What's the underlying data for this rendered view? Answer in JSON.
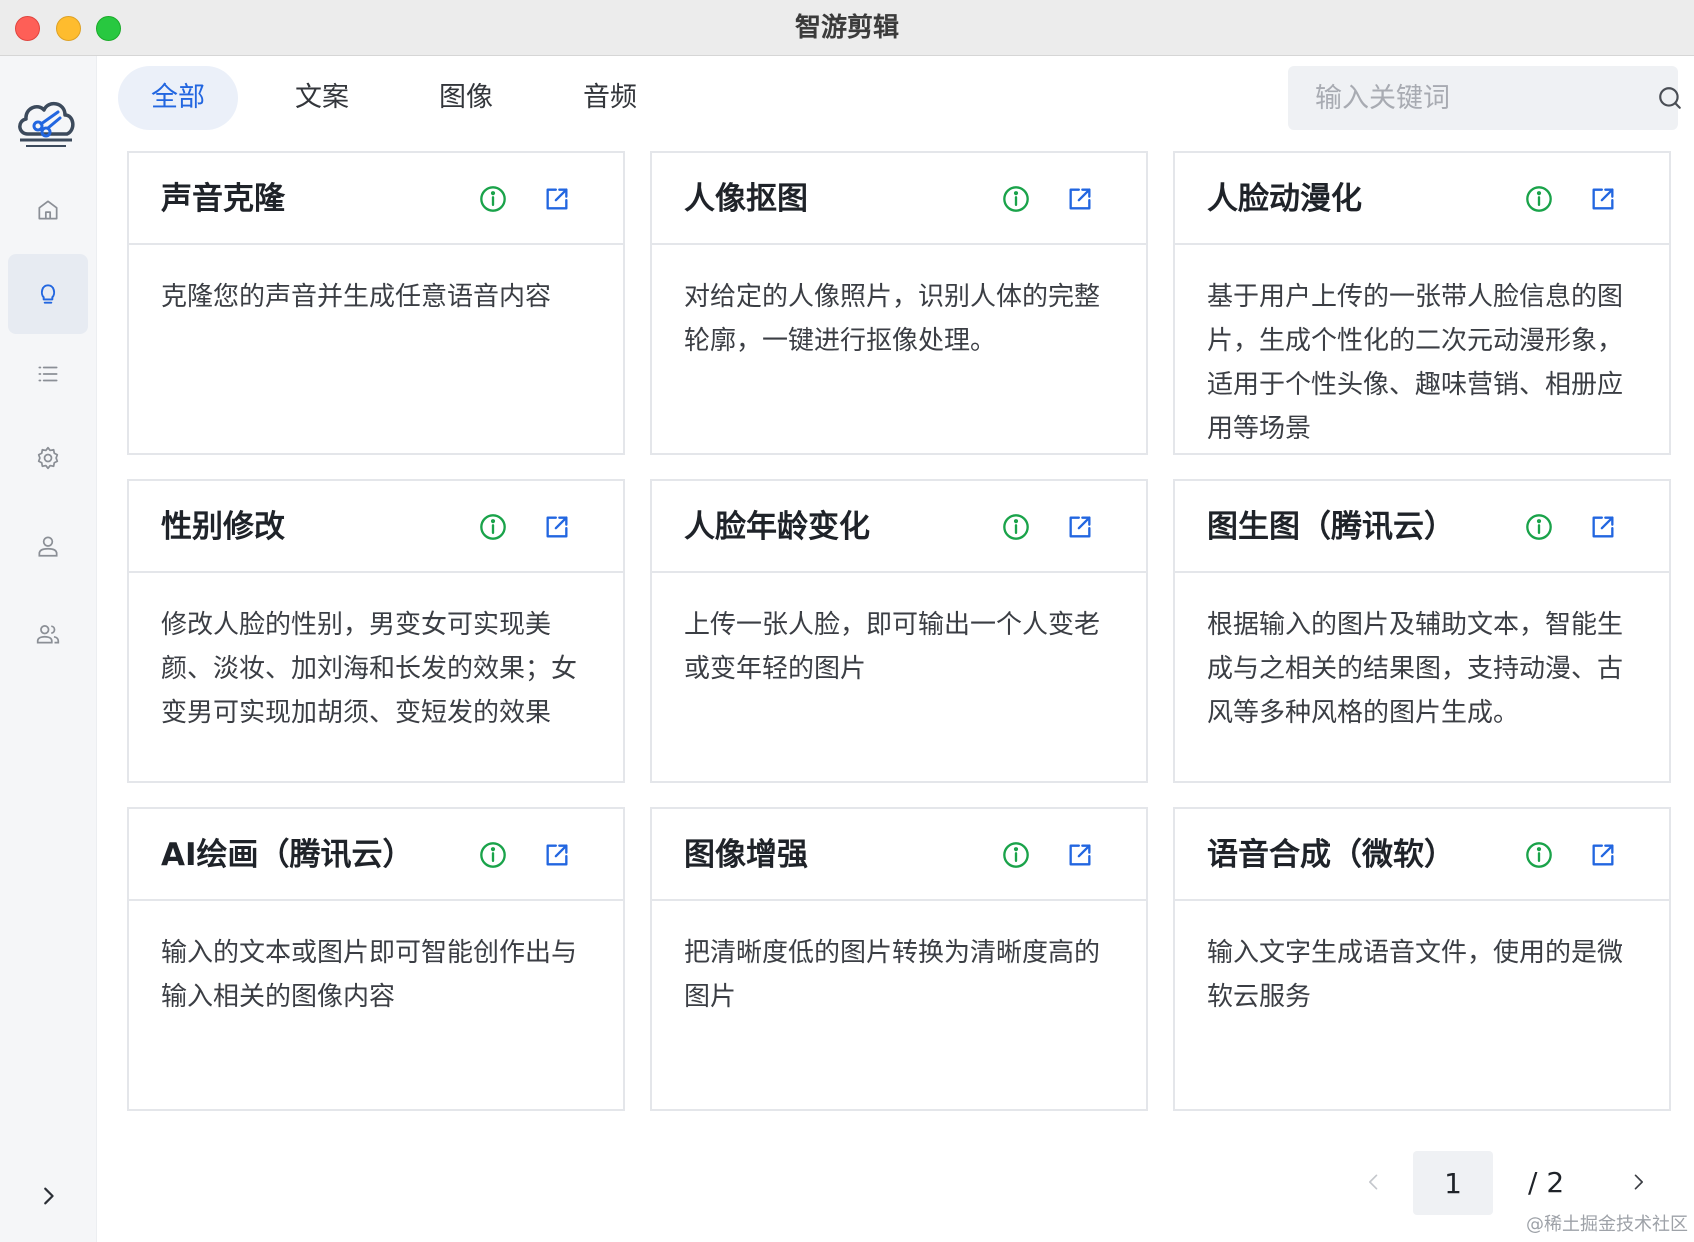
{
  "window": {
    "title": "智游剪辑"
  },
  "sidebar": {
    "logo_icon": "scissors-cloud-logo",
    "items": [
      {
        "icon": "home-icon",
        "active": false
      },
      {
        "icon": "lightbulb-icon",
        "active": true
      },
      {
        "icon": "list-icon",
        "active": false
      },
      {
        "icon": "gear-icon",
        "active": false
      },
      {
        "icon": "user-icon",
        "active": false
      },
      {
        "icon": "users-icon",
        "active": false
      }
    ],
    "collapse_icon": "chevron-right-icon"
  },
  "tabs": [
    {
      "label": "全部",
      "active": true
    },
    {
      "label": "文案",
      "active": false
    },
    {
      "label": "图像",
      "active": false
    },
    {
      "label": "音频",
      "active": false
    }
  ],
  "search": {
    "placeholder": "输入关键词",
    "value": ""
  },
  "cards": [
    {
      "title": "声音克隆",
      "desc": "克隆您的声音并生成任意语音内容"
    },
    {
      "title": "人像抠图",
      "desc": "对给定的人像照片，识别人体的完整轮廓，一键进行抠像处理。"
    },
    {
      "title": "人脸动漫化",
      "desc": "基于用户上传的一张带人脸信息的图片，生成个性化的二次元动漫形象，适用于个性头像、趣味营销、相册应用等场景"
    },
    {
      "title": "性别修改",
      "desc": "修改人脸的性别，男变女可实现美颜、淡妆、加刘海和长发的效果；女变男可实现加胡须、变短发的效果"
    },
    {
      "title": "人脸年龄变化",
      "desc": "上传一张人脸，即可输出一个人变老或变年轻的图片"
    },
    {
      "title": "图生图（腾讯云）",
      "desc": "根据输入的图片及辅助文本，智能生成与之相关的结果图，支持动漫、古风等多种风格的图片生成。"
    },
    {
      "title": "AI绘画（腾讯云）",
      "desc": "输入的文本或图片即可智能创作出与输入相关的图像内容"
    },
    {
      "title": "图像增强",
      "desc": "把清晰度低的图片转换为清晰度高的图片"
    },
    {
      "title": "语音合成（微软）",
      "desc": "输入文字生成语音文件，使用的是微软云服务"
    }
  ],
  "pagination": {
    "current": "1",
    "total_label": "/  2"
  },
  "watermark": "@稀土掘金技术社区",
  "colors": {
    "accent": "#2266e0",
    "info_green": "#1aa34a",
    "open_blue": "#2266e0",
    "sidebar_bg": "#f5f6f8",
    "active_nav_bg": "#e7ebf2"
  }
}
